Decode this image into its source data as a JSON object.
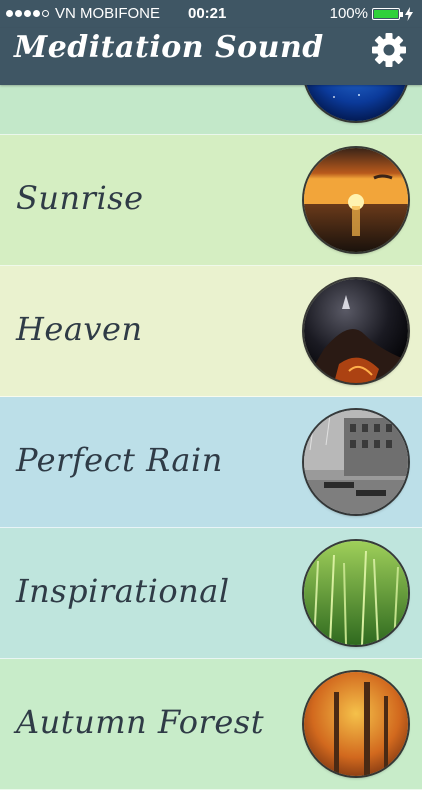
{
  "status_bar": {
    "carrier": "VN MOBIFONE",
    "time": "00:21",
    "battery_percent": "100%",
    "battery_level": 1.0,
    "signal_bars": 4,
    "signal_max": 5,
    "battery_color": "#2fd13a"
  },
  "header": {
    "title": "Meditation Sound",
    "settings_icon": "gear-icon",
    "background": "#3f5664"
  },
  "sounds": [
    {
      "label": "",
      "thumbnail": "starry-blue-orb-image",
      "background": "#c3e8c9"
    },
    {
      "label": "Sunrise",
      "thumbnail": "sunrise-ocean-image",
      "background": "#d5eec2"
    },
    {
      "label": "Heaven",
      "thumbnail": "heaven-dark-image",
      "background": "#eaf2cf"
    },
    {
      "label": "Perfect Rain",
      "thumbnail": "rainy-street-image",
      "background": "#bcdfe8"
    },
    {
      "label": "Inspirational",
      "thumbnail": "wheat-field-image",
      "background": "#bfe5dd"
    },
    {
      "label": "Autumn Forest",
      "thumbnail": "autumn-forest-image",
      "background": "#c8ecc9"
    }
  ]
}
